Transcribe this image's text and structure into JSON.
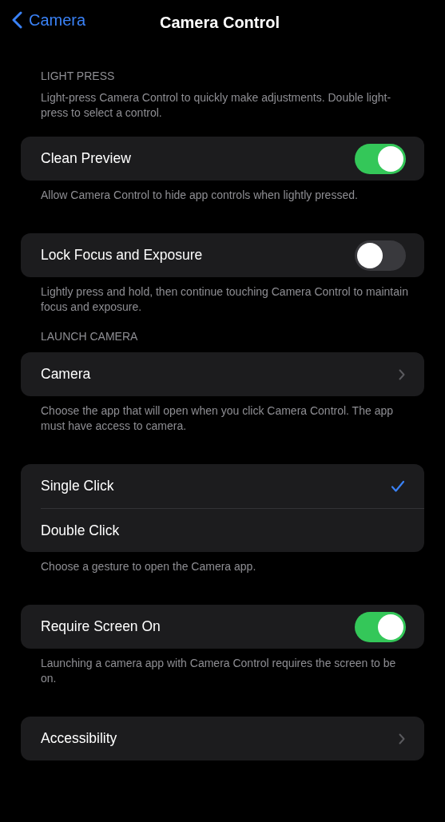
{
  "nav": {
    "back_label": "Camera",
    "title": "Camera Control"
  },
  "groups": [
    {
      "header": "LIGHT PRESS",
      "intro": "Light-press Camera Control to quickly make adjustments. Double light-press to select a control.",
      "rows": [
        {
          "kind": "toggle",
          "label": "Clean Preview",
          "on": true
        }
      ],
      "footer": "Allow Camera Control to hide app controls when lightly pressed."
    },
    {
      "rows": [
        {
          "kind": "toggle",
          "label": "Lock Focus and Exposure",
          "on": false
        }
      ],
      "footer": "Lightly press and hold, then continue touching Camera Control to maintain focus and exposure."
    },
    {
      "header": "LAUNCH CAMERA",
      "rows": [
        {
          "kind": "link",
          "label": "Camera"
        }
      ],
      "footer": "Choose the app that will open when you click Camera Control. The app must have access to camera."
    },
    {
      "rows": [
        {
          "kind": "option",
          "label": "Single Click",
          "selected": true
        },
        {
          "kind": "option",
          "label": "Double Click",
          "selected": false
        }
      ],
      "footer": "Choose a gesture to open the Camera app."
    },
    {
      "rows": [
        {
          "kind": "toggle",
          "label": "Require Screen On",
          "on": true
        }
      ],
      "footer": "Launching a camera app with Camera Control requires the screen to be on."
    },
    {
      "rows": [
        {
          "kind": "link",
          "label": "Accessibility"
        }
      ]
    }
  ]
}
